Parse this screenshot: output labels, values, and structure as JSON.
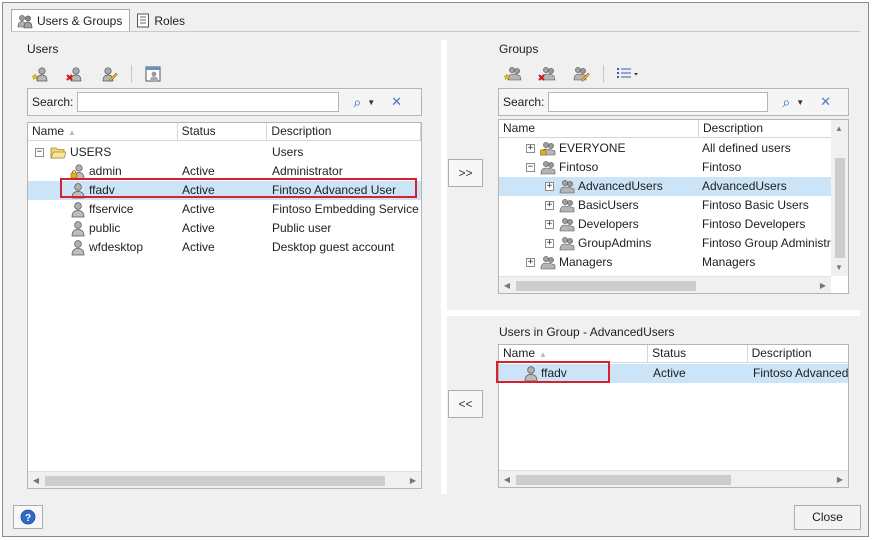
{
  "tabs": [
    {
      "label": "Users & Groups",
      "icon": "users-groups-icon",
      "active": true
    },
    {
      "label": "Roles",
      "icon": "roles-icon",
      "active": false
    }
  ],
  "users_panel": {
    "title": "Users",
    "search_label": "Search:",
    "search_value": "",
    "columns": [
      "Name",
      "Status",
      "Description"
    ],
    "rows": [
      {
        "name": "USERS",
        "status": "",
        "description": "Users",
        "type": "folder",
        "expander": "−"
      },
      {
        "name": "admin",
        "status": "Active",
        "description": "Administrator",
        "type": "admin-user"
      },
      {
        "name": "ffadv",
        "status": "Active",
        "description": "Fintoso Advanced User",
        "type": "user",
        "selected": true
      },
      {
        "name": "ffservice",
        "status": "Active",
        "description": "Fintoso Embedding Service Ac",
        "type": "user"
      },
      {
        "name": "public",
        "status": "Active",
        "description": "Public user",
        "type": "user"
      },
      {
        "name": "wfdesktop",
        "status": "Active",
        "description": "Desktop guest account",
        "type": "user"
      }
    ]
  },
  "move_buttons": {
    "add": ">>",
    "remove": "<<"
  },
  "groups_panel": {
    "title": "Groups",
    "search_label": "Search:",
    "search_value": "",
    "columns": [
      "Name",
      "Description"
    ],
    "rows": [
      {
        "name": "EVERYONE",
        "description": "All defined users",
        "level": 0,
        "expander": "+",
        "type": "group-lock"
      },
      {
        "name": "Fintoso",
        "description": "Fintoso",
        "level": 0,
        "expander": "−",
        "type": "group"
      },
      {
        "name": "AdvancedUsers",
        "description": "AdvancedUsers",
        "level": 1,
        "expander": "+",
        "type": "group",
        "selected": true
      },
      {
        "name": "BasicUsers",
        "description": "Fintoso Basic Users",
        "level": 1,
        "expander": "+",
        "type": "group"
      },
      {
        "name": "Developers",
        "description": "Fintoso Developers",
        "level": 1,
        "expander": "+",
        "type": "group"
      },
      {
        "name": "GroupAdmins",
        "description": "Fintoso Group Administrato",
        "level": 1,
        "expander": "+",
        "type": "group"
      },
      {
        "name": "Managers",
        "description": "Managers",
        "level": 0,
        "expander": "+",
        "type": "group"
      }
    ]
  },
  "members_panel": {
    "title": "Users in Group - AdvancedUsers",
    "columns": [
      "Name",
      "Status",
      "Description"
    ],
    "rows": [
      {
        "name": "ffadv",
        "status": "Active",
        "description": "Fintoso Advanced Us",
        "selected": true
      }
    ]
  },
  "footer": {
    "close_label": "Close",
    "help_icon": "help-icon"
  },
  "colors": {
    "selection": "#cce4f7",
    "highlight_box": "#d9202f",
    "accent": "#2a62b8"
  }
}
